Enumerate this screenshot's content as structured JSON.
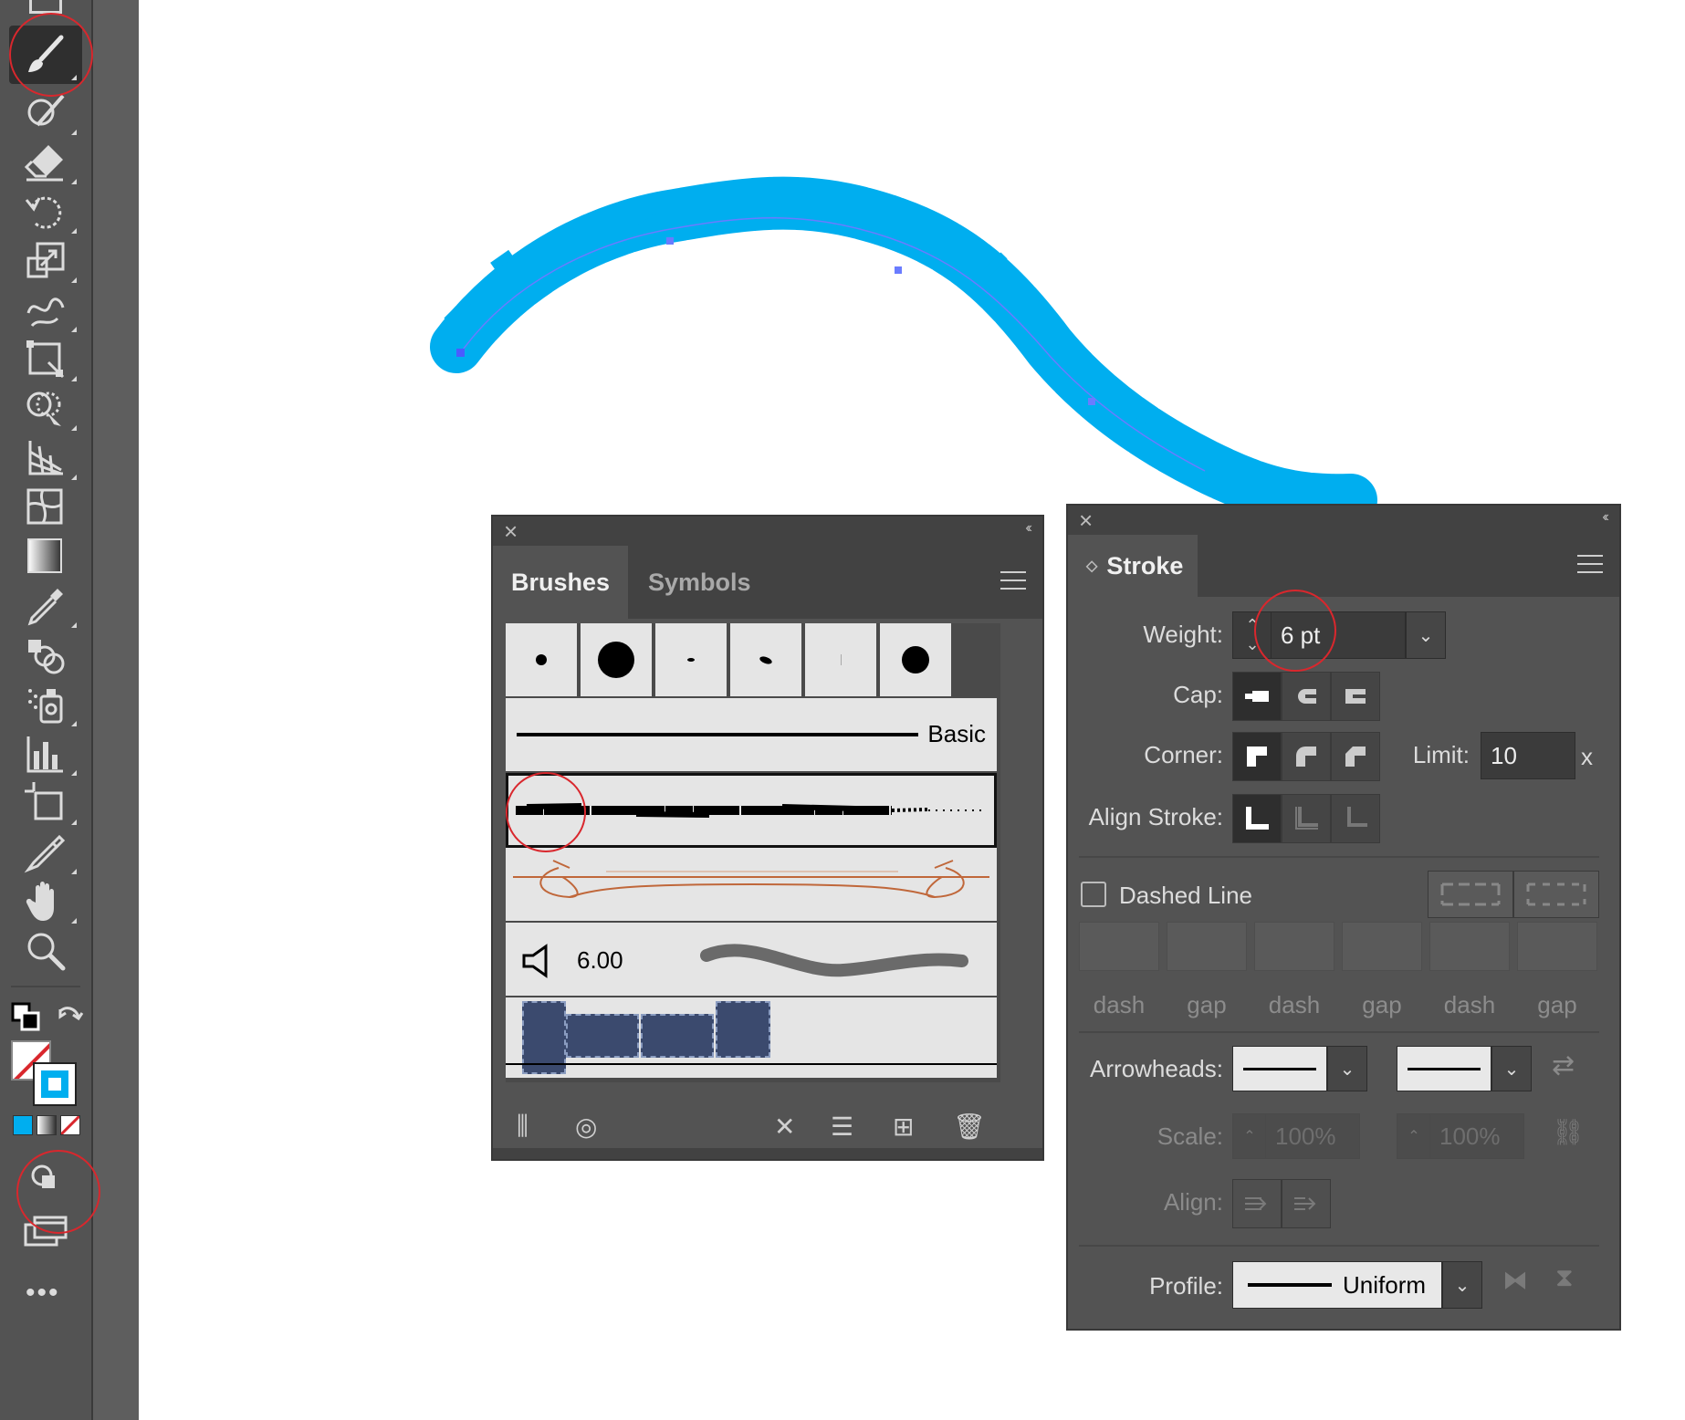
{
  "toolbar": {
    "tools": [
      "paintbrush-tool",
      "shaper-tool",
      "eraser-tool",
      "rotate-tool",
      "scale-tool",
      "warp-tool",
      "free-transform-tool",
      "shape-builder-tool",
      "perspective-grid-tool",
      "mesh-tool",
      "gradient-tool",
      "eyedropper-tool",
      "blend-tool",
      "symbol-sprayer-tool",
      "column-graph-tool",
      "artboard-tool",
      "slice-tool",
      "hand-tool",
      "zoom-tool"
    ],
    "more_label": "•••"
  },
  "colors": {
    "stroke_color": "#00aeef",
    "panel_bg": "#535353",
    "highlight": "#d9272d"
  },
  "brushes_panel": {
    "tabs": [
      "Brushes",
      "Symbols"
    ],
    "active_tab": "Brushes",
    "basic_label": "Basic",
    "bristle_value": "6.00",
    "selected_brush": "charcoal-brush"
  },
  "stroke_panel": {
    "title": "Stroke",
    "weight_label": "Weight:",
    "weight_value": "6 pt",
    "cap_label": "Cap:",
    "corner_label": "Corner:",
    "limit_label": "Limit:",
    "limit_value": "10",
    "limit_unit": "x",
    "align_stroke_label": "Align Stroke:",
    "dashed_line_label": "Dashed Line",
    "dashed_line_checked": false,
    "dash_labels": [
      "dash",
      "gap",
      "dash",
      "gap",
      "dash",
      "gap"
    ],
    "arrowheads_label": "Arrowheads:",
    "scale_label": "Scale:",
    "scale_start": "100%",
    "scale_end": "100%",
    "align_label": "Align:",
    "profile_label": "Profile:",
    "profile_value": "Uniform"
  }
}
